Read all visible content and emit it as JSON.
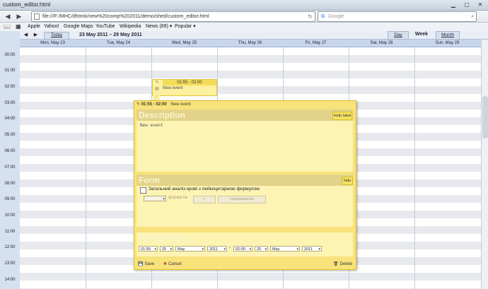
{
  "window": {
    "title": "custom_editor.html"
  },
  "browser": {
    "back": "◀",
    "forward": "▶",
    "url": "file:///F:/MHC/dhtmlx/new%20comp%202011/demo/shed/custom_editor.html",
    "search_placeholder": "Google",
    "bookmarks": [
      "Apple",
      "Yahoo!",
      "Google Maps",
      "YouTube",
      "Wikipedia",
      "News (89) ▾",
      "Popular ▾"
    ]
  },
  "scheduler": {
    "today_label": "Today",
    "date_range": "23 May 2011 – 29 May 2011",
    "views": [
      "Day",
      "Week",
      "Month"
    ],
    "active_view": "Week",
    "days": [
      "Mon, May 23",
      "Tue, May 24",
      "Wed, May 25",
      "Thu, May 26",
      "Fri, May 27",
      "Sat, May 28",
      "Sun, May 29"
    ],
    "times": [
      "00:00",
      "01:00",
      "02:00",
      "03:00",
      "04:00",
      "05:00",
      "06:00",
      "07:00",
      "08:00",
      "09:00",
      "10:00",
      "11:00",
      "12:00",
      "13:00",
      "14:00"
    ],
    "event": {
      "time": "01:55 - 02:00",
      "text": "New event"
    }
  },
  "lightbox": {
    "header_time": "01:55 - 02:00",
    "header_text": "New event",
    "description": {
      "title": "Description",
      "button": "Help label",
      "value": "New event"
    },
    "form": {
      "title": "Form",
      "button": "hide",
      "checkbox_label": "Загальний аналіз крові з лейкоцитарною формулою",
      "forma_label": "форма №",
      "plus_label": "+",
      "direction_label": "Направление"
    },
    "time_period": {
      "title": "Time period",
      "start": {
        "time": "01:55",
        "day": "25",
        "month": "May",
        "year": "2011"
      },
      "separator": "-",
      "end": {
        "time": "02:00",
        "day": "25",
        "month": "May",
        "year": "2011"
      }
    },
    "actions": {
      "save": "Save",
      "cancel": "Cancel",
      "delete": "Delete"
    }
  },
  "colors": {
    "lightbox_bg": "#f7e27b",
    "panel_head": "#e3d38a",
    "event_bg": "#fdf1a0"
  }
}
